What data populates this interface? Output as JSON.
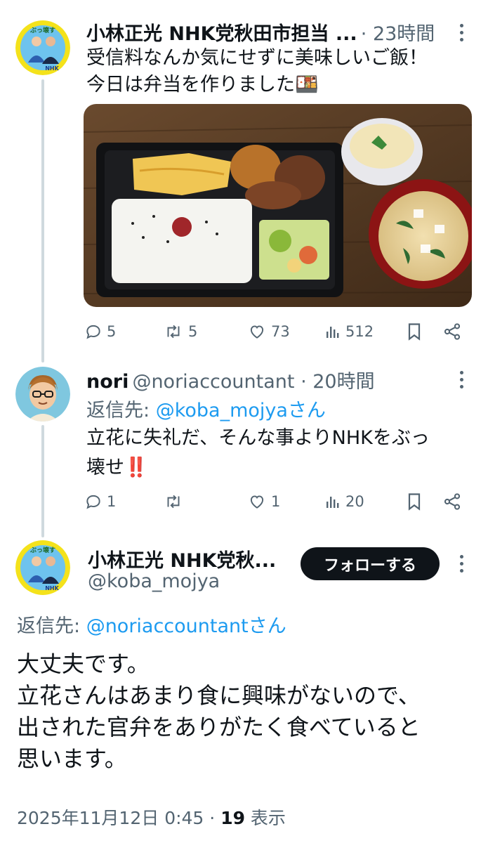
{
  "tweet1": {
    "display_name": "小林正光 NHK党秋田市担当 ...",
    "time": "23時間",
    "text_line1": "受信料なんか気にせずに美味しいご飯！",
    "text_line2": "今日は弁当を作りました",
    "emoji": "🍱",
    "image_alt": "弁当と茶碗蒸しと味噌汁",
    "actions": {
      "replies": "5",
      "retweets": "5",
      "likes": "73",
      "views": "512"
    }
  },
  "tweet2": {
    "display_name": "nori",
    "handle_time": "@noriaccountant · 20時間",
    "reply_prefix": "返信先: ",
    "reply_to": "@koba_mojyaさん",
    "text_line1": "立花に失礼だ、そんな事よりNHKをぶっ",
    "text_line2": "壊せ",
    "emoji": "‼️",
    "actions": {
      "replies": "1",
      "retweets": "",
      "likes": "1",
      "views": "20"
    }
  },
  "main": {
    "display_name": "小林正光 NHK党秋...",
    "handle": "@koba_mojya",
    "follow_label": "フォローする",
    "reply_prefix": "返信先: ",
    "reply_to": "@noriaccountantさん",
    "text_lines": [
      "大丈夫です。",
      "立花さんはあまり食に興味がないので、",
      "出された官弁をありがたく食べていると",
      "思います。"
    ],
    "date": "2025年11月12日 0:45 · ",
    "views_count": "19",
    "views_label": " 表示"
  },
  "colors": {
    "accent": "#1d9bf0",
    "text": "#0f1419",
    "muted": "#536471",
    "button": "#0f1419"
  }
}
